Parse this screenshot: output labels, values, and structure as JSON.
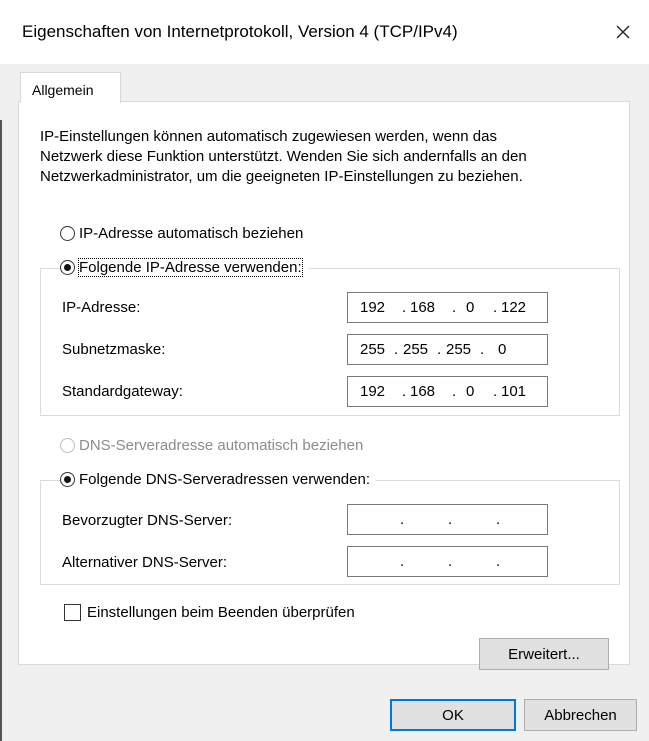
{
  "window": {
    "title": "Eigenschaften von Internetprotokoll, Version 4 (TCP/IPv4)",
    "close_icon": "close-icon"
  },
  "tabs": [
    {
      "label": "Allgemein",
      "active": true
    }
  ],
  "intro": {
    "lines": [
      "IP-Einstellungen können automatisch zugewiesen werden, wenn das",
      "Netzwerk diese Funktion unterstützt. Wenden Sie sich andernfalls an den",
      "Netzwerkadministrator, um die geeigneten IP-Einstellungen zu beziehen."
    ]
  },
  "ip_settings": {
    "auto_label": "IP-Adresse automatisch beziehen",
    "auto_selected": false,
    "manual_label": "Folgende IP-Adresse verwenden:",
    "manual_selected": true,
    "fields": [
      {
        "label": "IP-Adresse:",
        "octets": [
          "192",
          "168",
          "0",
          "122"
        ]
      },
      {
        "label": "Subnetzmaske:",
        "octets": [
          "255",
          "255",
          "255",
          "0"
        ]
      },
      {
        "label": "Standardgateway:",
        "octets": [
          "192",
          "168",
          "0",
          "101"
        ]
      }
    ]
  },
  "dns_settings": {
    "auto_label": "DNS-Serveradresse automatisch beziehen",
    "auto_selected": false,
    "auto_disabled": true,
    "manual_label": "Folgende DNS-Serveradressen verwenden:",
    "manual_selected": true,
    "fields": [
      {
        "label": "Bevorzugter DNS-Server:",
        "octets": [
          "",
          "",
          "",
          ""
        ]
      },
      {
        "label": "Alternativer DNS-Server:",
        "octets": [
          "",
          "",
          "",
          ""
        ]
      }
    ]
  },
  "validate_on_exit": {
    "label": "Einstellungen beim Beenden überprüfen",
    "checked": false
  },
  "buttons": {
    "advanced": "Erweitert...",
    "ok": "OK",
    "cancel": "Abbrechen"
  },
  "colors": {
    "default_button_border": "#0078d7",
    "disabled_text": "#8c8c8c"
  }
}
